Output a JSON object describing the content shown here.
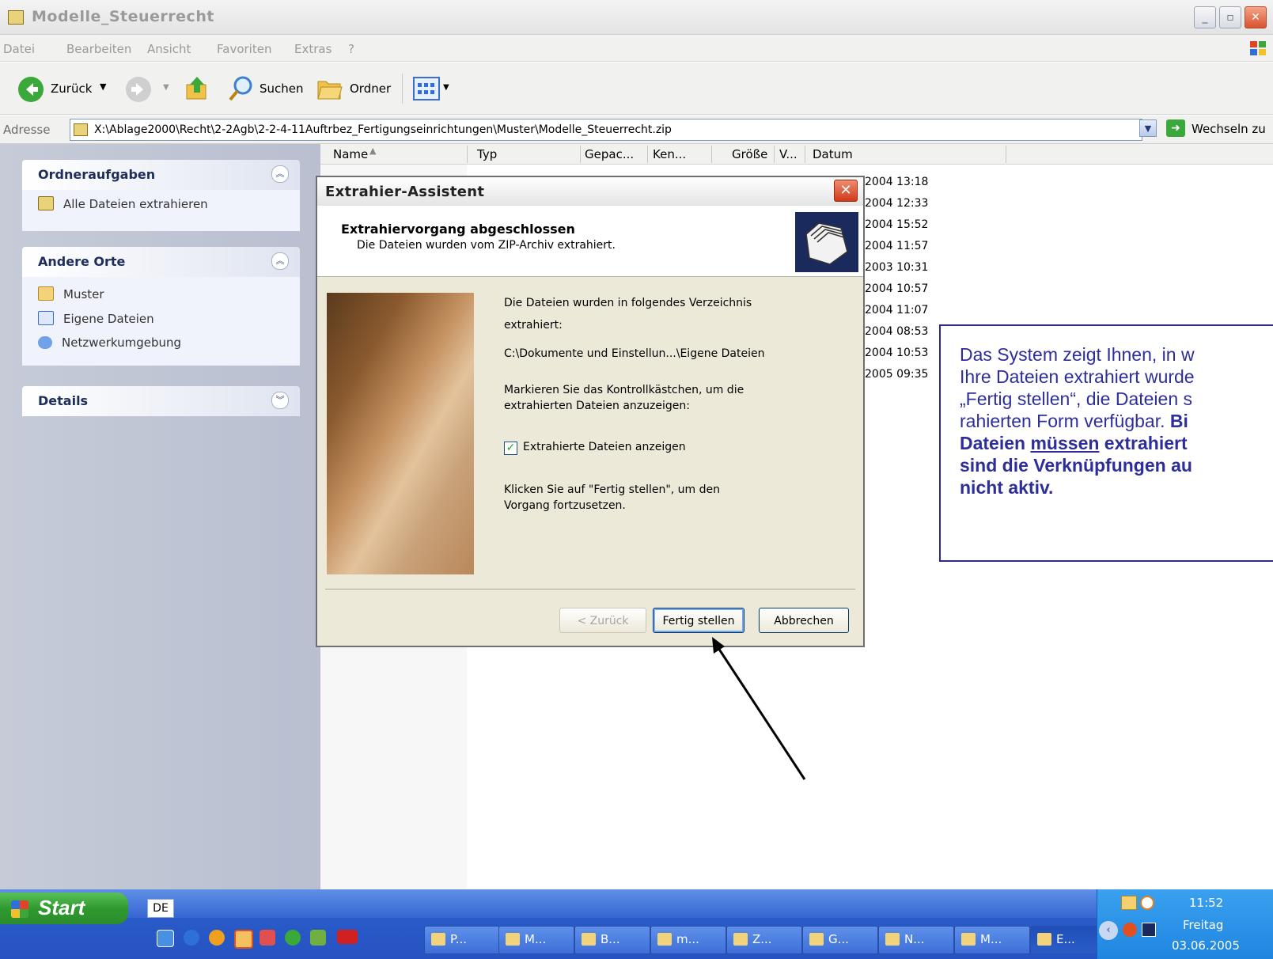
{
  "window": {
    "title": "Modelle_Steuerrecht",
    "menu": [
      "Datei",
      "Bearbeiten",
      "Ansicht",
      "Favoriten",
      "Extras",
      "?"
    ]
  },
  "toolbar": {
    "back_label": "Zurück",
    "search_label": "Suchen",
    "folders_label": "Ordner"
  },
  "address": {
    "label": "Adresse",
    "path": "X:\\Ablage2000\\Recht\\2-2Agb\\2-2-4-11Auftrbez_Fertigungseinrichtungen\\Muster\\Modelle_Steuerrecht.zip",
    "go_label": "Wechseln zu"
  },
  "left_pane": {
    "tasks": {
      "title": "Ordneraufgaben",
      "items": [
        "Alle Dateien extrahieren"
      ]
    },
    "other_places": {
      "title": "Andere Orte",
      "items": [
        "Muster",
        "Eigene Dateien",
        "Netzwerkumgebung"
      ]
    },
    "details": {
      "title": "Details"
    }
  },
  "file_list": {
    "columns": [
      "Name",
      "Typ",
      "Gepac...",
      "Ken...",
      "Größe",
      "V...",
      "Datum"
    ],
    "dates": [
      "2004 13:18",
      "2004 12:33",
      "2004 15:52",
      "2004 11:57",
      "2003 10:31",
      "2004 10:57",
      "2004 11:07",
      "2004 08:53",
      "2004 10:53",
      "2005 09:35"
    ]
  },
  "wizard": {
    "title": "Extrahier-Assistent",
    "heading": "Extrahiervorgang abgeschlossen",
    "subheading": "Die Dateien wurden vom ZIP-Archiv extrahiert.",
    "line1": "Die Dateien wurden in folgendes Verzeichnis",
    "line2": "extrahiert:",
    "target_path": "C:\\Dokumente und Einstellun...\\Eigene Dateien",
    "mark_line1": "Markieren Sie das Kontrollkästchen, um die",
    "mark_line2": "extrahierten Dateien anzuzeigen:",
    "checkbox_label": "Extrahierte Dateien anzeigen",
    "checkbox_checked": true,
    "finish_line1": "Klicken Sie auf \"Fertig stellen\", um den",
    "finish_line2": "Vorgang fortzusetzen.",
    "back_button": "< Zurück",
    "finish_button": "Fertig stellen",
    "cancel_button": "Abbrechen"
  },
  "callout": {
    "line1": "Das System zeigt Ihnen, in w",
    "line2": "Ihre Dateien extrahiert wurde",
    "line3": "„Fertig stellen“, die Dateien s",
    "line4a": "rahierten Form verfügbar. ",
    "line4b": "Bi",
    "line5a": "Dateien ",
    "line5b": "müssen",
    "line5c": " extrahiert",
    "line6": "sind die Verknüpfungen au",
    "line7": "nicht aktiv."
  },
  "taskbar": {
    "start_label": "Start",
    "language": "DE",
    "buttons": [
      "P...",
      "M...",
      "B...",
      "m...",
      "Z...",
      "G...",
      "N...",
      "M...",
      "E..."
    ],
    "clock": "11:52",
    "day": "Freitag",
    "date": "03.06.2005"
  },
  "colors": {
    "callout_text": "#2e2e9a",
    "callout_border": "#2a2a8c",
    "taskbar": "#2653c2",
    "start_button": "#2f9a2f"
  }
}
